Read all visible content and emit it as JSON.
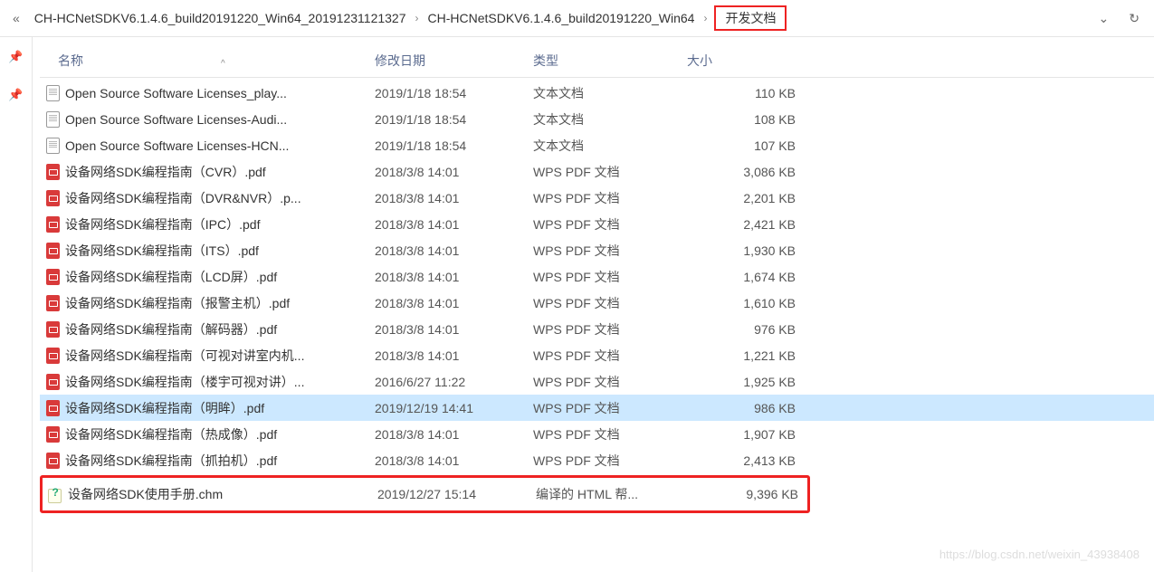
{
  "breadcrumb": {
    "back_glyph": "«",
    "items": [
      "CH-HCNetSDKV6.1.4.6_build20191220_Win64_20191231121327",
      "CH-HCNetSDKV6.1.4.6_build20191220_Win64"
    ],
    "sep": "›",
    "current": "开发文档",
    "dropdown_glyph": "⌄",
    "refresh_glyph": "↻"
  },
  "rail": {
    "pin1": "📌",
    "pin2": "📌"
  },
  "columns": {
    "name": "名称",
    "date": "修改日期",
    "type": "类型",
    "size": "大小",
    "sort_glyph": "^"
  },
  "files": [
    {
      "icon": "txt",
      "name": "Open Source Software Licenses_play...",
      "date": "2019/1/18 18:54",
      "type": "文本文档",
      "size": "110 KB"
    },
    {
      "icon": "txt",
      "name": "Open Source Software Licenses-Audi...",
      "date": "2019/1/18 18:54",
      "type": "文本文档",
      "size": "108 KB"
    },
    {
      "icon": "txt",
      "name": "Open Source Software Licenses-HCN...",
      "date": "2019/1/18 18:54",
      "type": "文本文档",
      "size": "107 KB"
    },
    {
      "icon": "pdf",
      "name": "设备网络SDK编程指南（CVR）.pdf",
      "date": "2018/3/8 14:01",
      "type": "WPS PDF 文档",
      "size": "3,086 KB"
    },
    {
      "icon": "pdf",
      "name": "设备网络SDK编程指南（DVR&NVR）.p...",
      "date": "2018/3/8 14:01",
      "type": "WPS PDF 文档",
      "size": "2,201 KB"
    },
    {
      "icon": "pdf",
      "name": "设备网络SDK编程指南（IPC）.pdf",
      "date": "2018/3/8 14:01",
      "type": "WPS PDF 文档",
      "size": "2,421 KB"
    },
    {
      "icon": "pdf",
      "name": "设备网络SDK编程指南（ITS）.pdf",
      "date": "2018/3/8 14:01",
      "type": "WPS PDF 文档",
      "size": "1,930 KB"
    },
    {
      "icon": "pdf",
      "name": "设备网络SDK编程指南（LCD屏）.pdf",
      "date": "2018/3/8 14:01",
      "type": "WPS PDF 文档",
      "size": "1,674 KB"
    },
    {
      "icon": "pdf",
      "name": "设备网络SDK编程指南（报警主机）.pdf",
      "date": "2018/3/8 14:01",
      "type": "WPS PDF 文档",
      "size": "1,610 KB"
    },
    {
      "icon": "pdf",
      "name": "设备网络SDK编程指南（解码器）.pdf",
      "date": "2018/3/8 14:01",
      "type": "WPS PDF 文档",
      "size": "976 KB"
    },
    {
      "icon": "pdf",
      "name": "设备网络SDK编程指南（可视对讲室内机...",
      "date": "2018/3/8 14:01",
      "type": "WPS PDF 文档",
      "size": "1,221 KB"
    },
    {
      "icon": "pdf",
      "name": "设备网络SDK编程指南（楼宇可视对讲）...",
      "date": "2016/6/27 11:22",
      "type": "WPS PDF 文档",
      "size": "1,925 KB"
    },
    {
      "icon": "pdf",
      "name": "设备网络SDK编程指南（明眸）.pdf",
      "date": "2019/12/19 14:41",
      "type": "WPS PDF 文档",
      "size": "986 KB",
      "selected": true
    },
    {
      "icon": "pdf",
      "name": "设备网络SDK编程指南（热成像）.pdf",
      "date": "2018/3/8 14:01",
      "type": "WPS PDF 文档",
      "size": "1,907 KB"
    },
    {
      "icon": "pdf",
      "name": "设备网络SDK编程指南（抓拍机）.pdf",
      "date": "2018/3/8 14:01",
      "type": "WPS PDF 文档",
      "size": "2,413 KB"
    },
    {
      "icon": "chm",
      "name": "设备网络SDK使用手册.chm",
      "date": "2019/12/27 15:14",
      "type": "编译的 HTML 帮...",
      "size": "9,396 KB",
      "highlighted": true
    }
  ],
  "watermark": "https://blog.csdn.net/weixin_43938408"
}
